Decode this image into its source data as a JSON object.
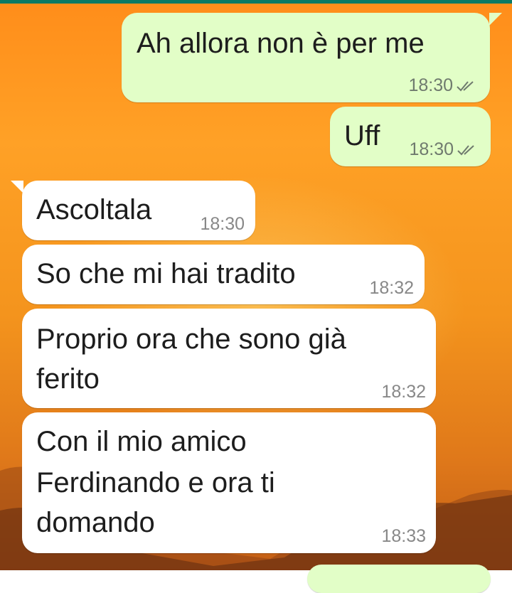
{
  "messages": [
    {
      "direction": "outgoing",
      "text": "Ah allora non è per me",
      "time": "18:30",
      "status": "read"
    },
    {
      "direction": "outgoing",
      "text": "Uff",
      "time": "18:30",
      "status": "read"
    },
    {
      "direction": "incoming",
      "text": "Ascoltala",
      "time": "18:30"
    },
    {
      "direction": "incoming",
      "text": "So che mi hai tradito",
      "time": "18:32"
    },
    {
      "direction": "incoming",
      "lines": [
        "Proprio ora che sono già",
        "ferito"
      ],
      "time": "18:32"
    },
    {
      "direction": "incoming",
      "lines": [
        "Con il mio amico",
        "Ferdinando e ora ti",
        "domando"
      ],
      "time": "18:33"
    }
  ],
  "colors": {
    "outgoing_bubble": "#e2fec7",
    "incoming_bubble": "#ffffff",
    "read_ticks": "#6f7a6e",
    "top_bar": "#0b7a64",
    "wallpaper": "#f4941d"
  },
  "icons": {
    "read_receipt": "double-check-icon"
  }
}
